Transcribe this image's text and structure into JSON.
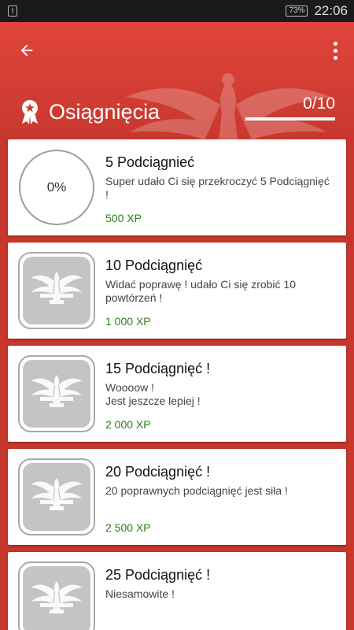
{
  "status_bar": {
    "notification_glyph": "!",
    "battery": "73%",
    "time": "22:06"
  },
  "header": {
    "title": "Osiągnięcia",
    "progress_text": "0/10",
    "progress_fraction": 0,
    "back_icon": "arrow-back-icon",
    "menu_icon": "more-vert-icon",
    "title_icon": "award-icon"
  },
  "colors": {
    "brand_red": "#c8372d",
    "xp_green": "#2e7d1a"
  },
  "achievements": [
    {
      "title": "5 Podciągnieć",
      "description": "Super udało Ci się przekroczyć 5 Podciągnięć !",
      "xp": "500 XP",
      "badge": "0%"
    },
    {
      "title": "10 Podciągnięć",
      "description": "Widać poprawę ! udało Ci się zrobić 10 powtórzeń !",
      "xp": "1 000 XP",
      "badge": "locked-eagle-icon"
    },
    {
      "title": "15 Podciągnięć !",
      "description": "Woooow !\nJest jeszcze lepiej !",
      "xp": "2 000 XP",
      "badge": "locked-eagle-icon"
    },
    {
      "title": "20 Podciągnięć !",
      "description": "20 poprawnych podciągnięć jest siła !",
      "xp": "2 500 XP",
      "badge": "locked-eagle-icon"
    },
    {
      "title": "25 Podciągnięć !",
      "description": "Niesamowite !",
      "xp": "",
      "badge": "locked-eagle-icon"
    }
  ]
}
